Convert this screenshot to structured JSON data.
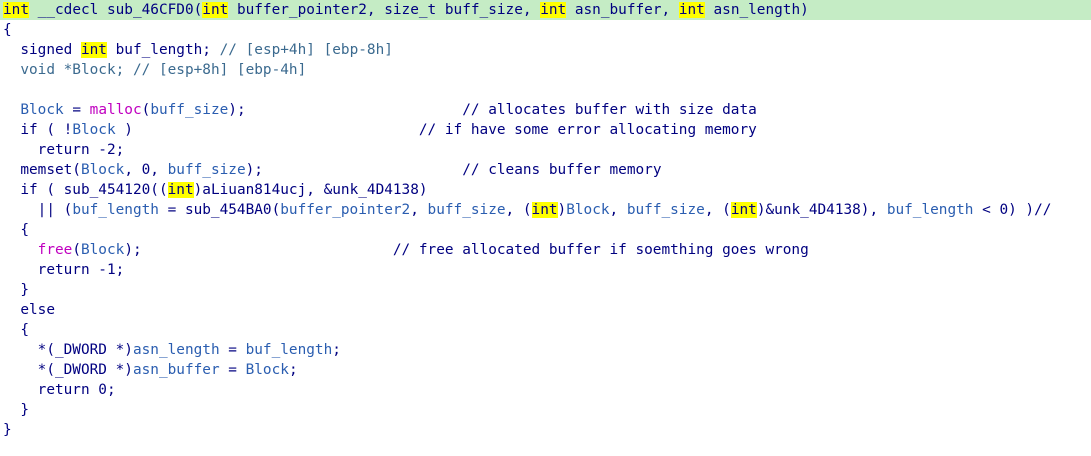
{
  "editor": {
    "current_line_index": 0,
    "lines": [
      [
        {
          "t": "int",
          "c": "hl"
        },
        {
          "t": " __cdecl sub_46CFD0(",
          "c": "kw"
        },
        {
          "t": "int",
          "c": "hl"
        },
        {
          "t": " buffer_pointer2, size_t buff_size, ",
          "c": "kw"
        },
        {
          "t": "int",
          "c": "hl"
        },
        {
          "t": " asn_buffer, ",
          "c": "kw"
        },
        {
          "t": "int",
          "c": "hl"
        },
        {
          "t": " asn_length)",
          "c": "kw"
        }
      ],
      [
        {
          "t": "{",
          "c": "kw"
        }
      ],
      [
        {
          "t": "  signed ",
          "c": "kw"
        },
        {
          "t": "int",
          "c": "hl"
        },
        {
          "t": " buf_length; ",
          "c": "kw"
        },
        {
          "t": "// [esp+4h] [ebp-8h]",
          "c": "cmt"
        }
      ],
      [
        {
          "t": "  void *Block; ",
          "c": "cmt"
        },
        {
          "t": "// [esp+8h] [ebp-4h]",
          "c": "cmt"
        }
      ],
      [],
      [
        {
          "t": "  Block",
          "c": "var"
        },
        {
          "t": " = ",
          "c": "kw"
        },
        {
          "t": "malloc",
          "c": "mag"
        },
        {
          "t": "(",
          "c": "kw"
        },
        {
          "t": "buff_size",
          "c": "var"
        },
        {
          "t": ");",
          "c": "kw"
        },
        {
          "t": "                         // allocates buffer with size data",
          "c": "kw"
        }
      ],
      [
        {
          "t": "  if ( !",
          "c": "kw"
        },
        {
          "t": "Block",
          "c": "var"
        },
        {
          "t": " )",
          "c": "kw"
        },
        {
          "t": "                                 // if have some error allocating memory",
          "c": "kw"
        }
      ],
      [
        {
          "t": "    return -2;",
          "c": "kw"
        }
      ],
      [
        {
          "t": "  memset(",
          "c": "kw"
        },
        {
          "t": "Block",
          "c": "var"
        },
        {
          "t": ", 0, ",
          "c": "kw"
        },
        {
          "t": "buff_size",
          "c": "var"
        },
        {
          "t": ");",
          "c": "kw"
        },
        {
          "t": "                       // cleans buffer memory",
          "c": "kw"
        }
      ],
      [
        {
          "t": "  if ( sub_454120((",
          "c": "kw"
        },
        {
          "t": "int",
          "c": "hl"
        },
        {
          "t": ")aLiuan814ucj, &unk_4D4138)",
          "c": "kw"
        }
      ],
      [
        {
          "t": "    || (",
          "c": "kw"
        },
        {
          "t": "buf_length",
          "c": "var"
        },
        {
          "t": " = sub_454BA0(",
          "c": "kw"
        },
        {
          "t": "buffer_pointer2",
          "c": "var"
        },
        {
          "t": ", ",
          "c": "kw"
        },
        {
          "t": "buff_size",
          "c": "var"
        },
        {
          "t": ", (",
          "c": "kw"
        },
        {
          "t": "int",
          "c": "hl"
        },
        {
          "t": ")",
          "c": "kw"
        },
        {
          "t": "Block",
          "c": "var"
        },
        {
          "t": ", ",
          "c": "kw"
        },
        {
          "t": "buff_size",
          "c": "var"
        },
        {
          "t": ", (",
          "c": "kw"
        },
        {
          "t": "int",
          "c": "hl"
        },
        {
          "t": ")&unk_4D4138), ",
          "c": "kw"
        },
        {
          "t": "buf_length",
          "c": "var"
        },
        {
          "t": " < 0) )//",
          "c": "kw"
        }
      ],
      [
        {
          "t": "  {",
          "c": "kw"
        }
      ],
      [
        {
          "t": "    ",
          "c": "kw"
        },
        {
          "t": "free",
          "c": "mag"
        },
        {
          "t": "(",
          "c": "kw"
        },
        {
          "t": "Block",
          "c": "var"
        },
        {
          "t": ");",
          "c": "kw"
        },
        {
          "t": "                             // free allocated buffer if soemthing goes wrong",
          "c": "kw"
        }
      ],
      [
        {
          "t": "    return -1;",
          "c": "kw"
        }
      ],
      [
        {
          "t": "  }",
          "c": "kw"
        }
      ],
      [
        {
          "t": "  else",
          "c": "kw"
        }
      ],
      [
        {
          "t": "  {",
          "c": "kw"
        }
      ],
      [
        {
          "t": "    *(_DWORD *)",
          "c": "kw"
        },
        {
          "t": "asn_length",
          "c": "var"
        },
        {
          "t": " = ",
          "c": "kw"
        },
        {
          "t": "buf_length",
          "c": "var"
        },
        {
          "t": ";",
          "c": "kw"
        }
      ],
      [
        {
          "t": "    *(_DWORD *)",
          "c": "kw"
        },
        {
          "t": "asn_buffer",
          "c": "var"
        },
        {
          "t": " = ",
          "c": "kw"
        },
        {
          "t": "Block",
          "c": "var"
        },
        {
          "t": ";",
          "c": "kw"
        }
      ],
      [
        {
          "t": "    return 0;",
          "c": "kw"
        }
      ],
      [
        {
          "t": "  }",
          "c": "kw"
        }
      ],
      [
        {
          "t": "}",
          "c": "kw"
        }
      ]
    ]
  }
}
